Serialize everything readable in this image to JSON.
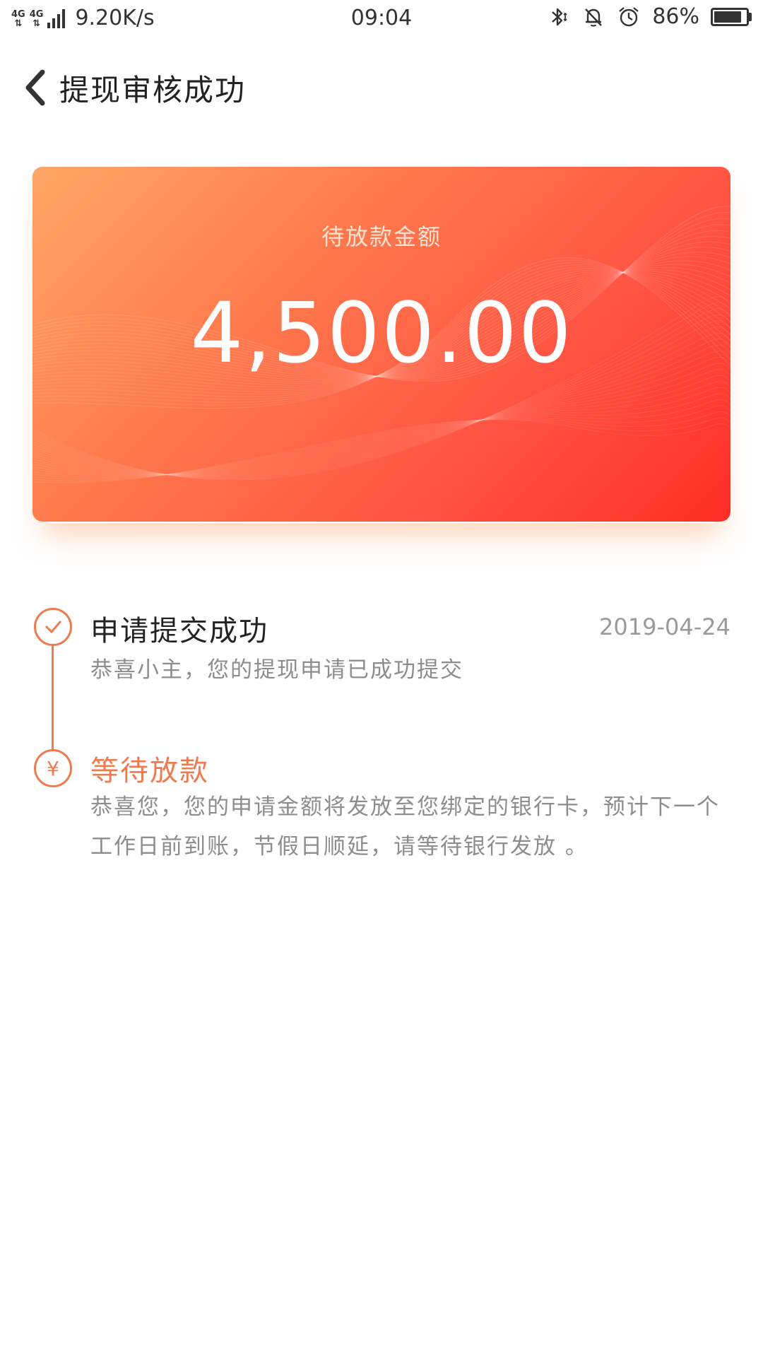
{
  "status_bar": {
    "network": "4G",
    "speed": "9.20K/s",
    "time": "09:04",
    "battery": "86%",
    "battery_level": 0.86,
    "icons": [
      "bluetooth-icon",
      "bell-muted-icon",
      "alarm-icon"
    ]
  },
  "header": {
    "title": "提现审核成功",
    "back_icon": "chevron-left-icon"
  },
  "card": {
    "label": "待放款金额",
    "amount": "4,500.00",
    "gradient": [
      "#ffa767",
      "#ff2d26"
    ]
  },
  "timeline": {
    "accent": "#ef7a50",
    "steps": [
      {
        "icon": "check-icon",
        "title": "申请提交成功",
        "date": "2019-04-24",
        "desc": "恭喜小主，您的提现申请已成功提交"
      },
      {
        "icon": "yen-icon",
        "symbol": "¥",
        "title": "等待放款",
        "desc": "恭喜您，您的申请金额将发放至您绑定的银行卡，预计下一个工作日前到账，节假日顺延，请等待银行发放 。"
      }
    ]
  }
}
